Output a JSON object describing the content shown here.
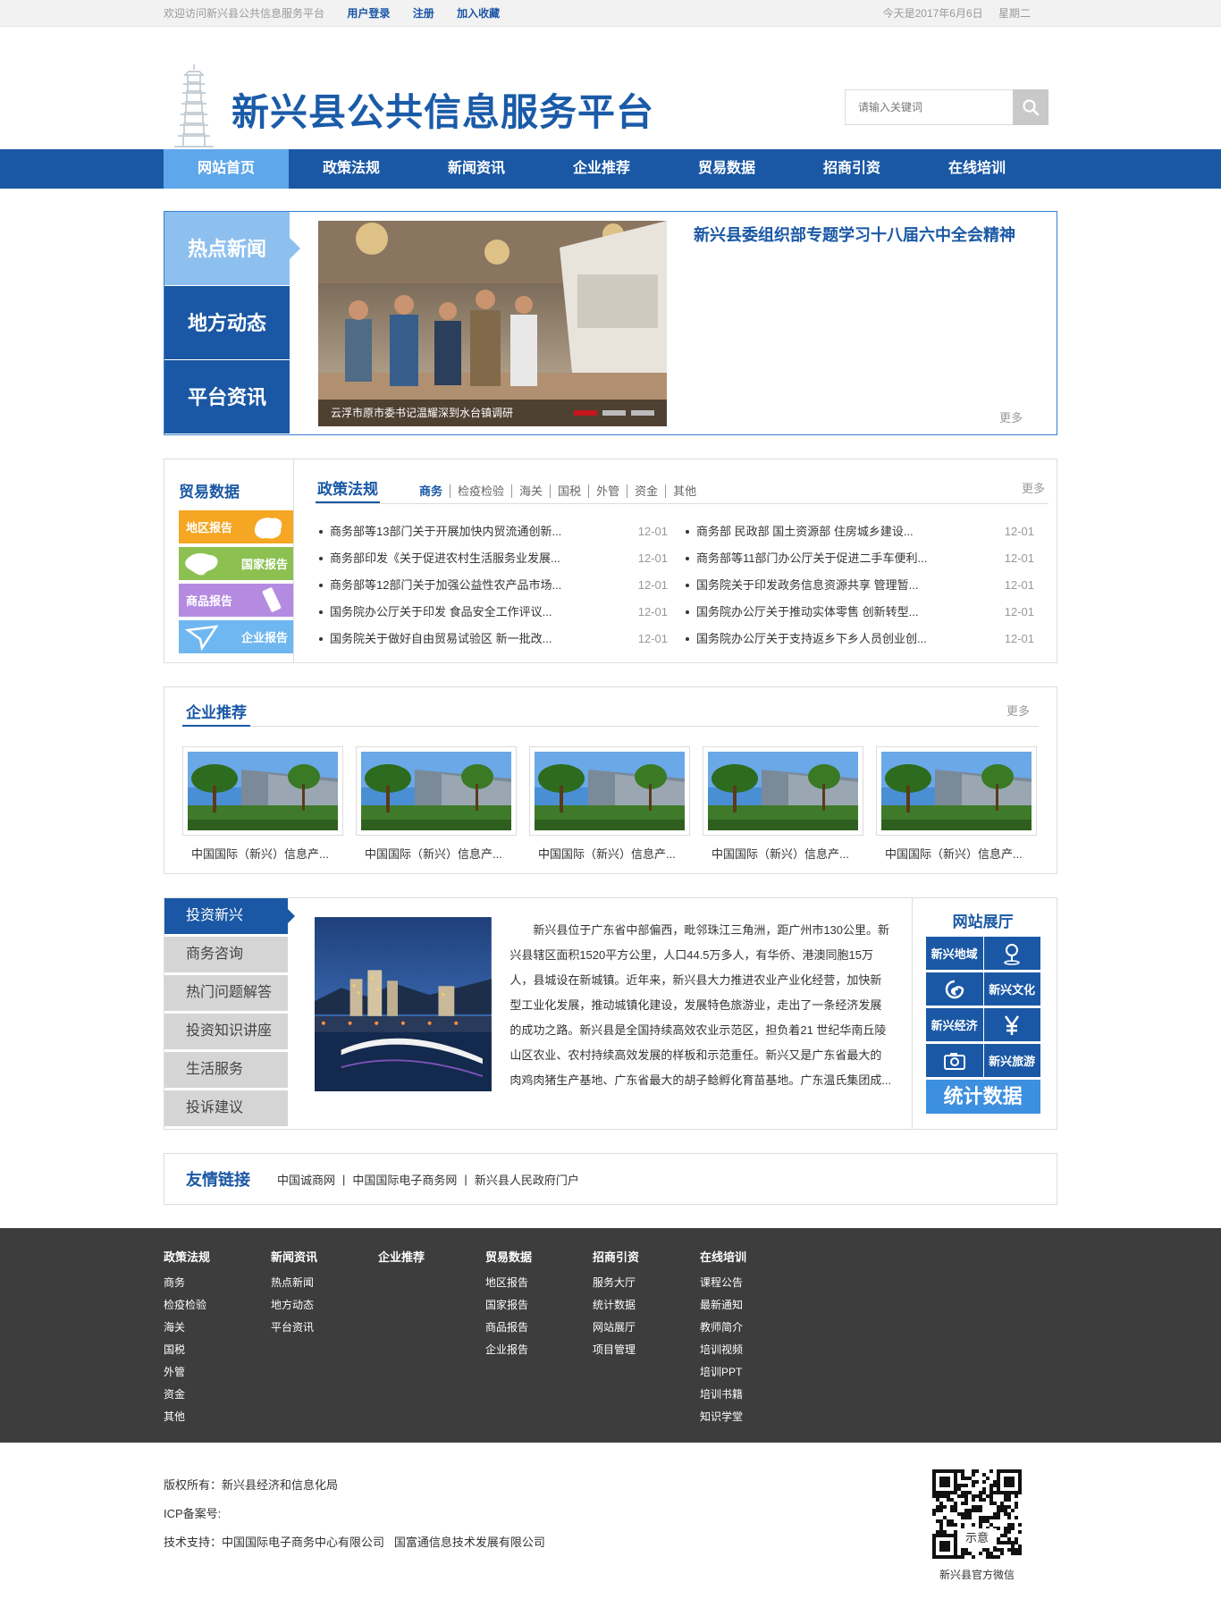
{
  "topbar": {
    "welcome": "欢迎访问新兴县公共信息服务平台",
    "login": "用户登录",
    "register": "注册",
    "favorite": "加入收藏",
    "date": "今天是2017年6月6日",
    "weekday": "星期二"
  },
  "header": {
    "title": "新兴县公共信息服务平台",
    "search_placeholder": "请输入关键词"
  },
  "nav": [
    "网站首页",
    "政策法规",
    "新闻资讯",
    "企业推荐",
    "贸易数据",
    "招商引资",
    "在线培训"
  ],
  "hot": {
    "tabs": [
      "热点新闻",
      "地方动态",
      "平台资讯"
    ],
    "caption": "云浮市原市委书记温耀深到水台镇调研",
    "headline": "新兴县委组织部专题学习十八届六中全会精神",
    "more": "更多"
  },
  "trade": {
    "title": "贸易数据",
    "reports": [
      "地区报告",
      "国家报告",
      "商品报告",
      "企业报告"
    ],
    "colors": [
      "#f5a623",
      "#8cc152",
      "#b48be0",
      "#6fb7f0"
    ]
  },
  "policy": {
    "title": "政策法规",
    "cats": [
      "商务",
      "检疫检验",
      "海关",
      "国税",
      "外管",
      "资金",
      "其他"
    ],
    "more": "更多",
    "left": [
      {
        "t": "商务部等13部门关于开展加快内贸流通创新...",
        "d": "12-01"
      },
      {
        "t": "商务部印发《关于促进农村生活服务业发展...",
        "d": "12-01"
      },
      {
        "t": "商务部等12部门关于加强公益性农产品市场...",
        "d": "12-01"
      },
      {
        "t": "国务院办公厅关于印发 食品安全工作评议...",
        "d": "12-01"
      },
      {
        "t": "国务院关于做好自由贸易试验区 新一批改...",
        "d": "12-01"
      }
    ],
    "right": [
      {
        "t": "商务部 民政部 国土资源部 住房城乡建设...",
        "d": "12-01"
      },
      {
        "t": "商务部等11部门办公厅关于促进二手车便利...",
        "d": "12-01"
      },
      {
        "t": "国务院关于印发政务信息资源共享 管理暂...",
        "d": "12-01"
      },
      {
        "t": "国务院办公厅关于推动实体零售 创新转型...",
        "d": "12-01"
      },
      {
        "t": "国务院办公厅关于支持返乡下乡人员创业创...",
        "d": "12-01"
      }
    ]
  },
  "enterprise": {
    "title": "企业推荐",
    "more": "更多",
    "items": [
      "中国国际（新兴）信息产...",
      "中国国际（新兴）信息产...",
      "中国国际（新兴）信息产...",
      "中国国际（新兴）信息产...",
      "中国国际（新兴）信息产..."
    ]
  },
  "invest": {
    "menu": [
      "投资新兴",
      "商务咨询",
      "热门问题解答",
      "投资知识讲座",
      "生活服务",
      "投诉建议"
    ],
    "text": "新兴县位于广东省中部偏西，毗邻珠江三角洲，距广州市130公里。新兴县辖区面积1520平方公里，人口44.5万多人，有华侨、港澳同胞15万人，县城设在新城镇。近年来，新兴县大力推进农业产业化经营，加快新型工业化发展，推动城镇化建设，发展特色旅游业，走出了一条经济发展的成功之路。新兴县是全国持续高效农业示范区，担负着21 世纪华南丘陵山区农业、农村持续高效发展的样板和示范重任。新兴又是广东省最大的肉鸡肉猪生产基地、广东省最大的胡子鲶孵化育苗基地。广东温氏集团成..."
  },
  "hall": {
    "title": "网站展厅",
    "items": [
      "新兴地域",
      "新兴文化",
      "新兴经济",
      "新兴旅游"
    ],
    "stat": "统计数据"
  },
  "links": {
    "title": "友情链接",
    "items": [
      "中国诚商网",
      "中国国际电子商务网",
      "新兴县人民政府门户"
    ]
  },
  "footer": {
    "cols": [
      {
        "h": "政策法规",
        "items": [
          "商务",
          "检疫检验",
          "海关",
          "国税",
          "外管",
          "资金",
          "其他"
        ]
      },
      {
        "h": "新闻资讯",
        "items": [
          "热点新闻",
          "地方动态",
          "平台资讯"
        ]
      },
      {
        "h": "企业推荐",
        "items": []
      },
      {
        "h": "贸易数据",
        "items": [
          "地区报告",
          "国家报告",
          "商品报告",
          "企业报告"
        ]
      },
      {
        "h": "招商引资",
        "items": [
          "服务大厅",
          "统计数据",
          "网站展厅",
          "项目管理"
        ]
      },
      {
        "h": "在线培训",
        "items": [
          "课程公告",
          "最新通知",
          "教师简介",
          "培训视频",
          "培训PPT",
          "培训书籍",
          "知识学堂"
        ]
      }
    ]
  },
  "bottom": {
    "copyright": "版权所有：新兴县经济和信息化局",
    "icp": "ICP备案号:",
    "support": "技术支持：中国国际电子商务中心有限公司   国富通信息技术发展有限公司",
    "qr_badge": "示意",
    "qr_caption": "新兴县官方微信"
  }
}
